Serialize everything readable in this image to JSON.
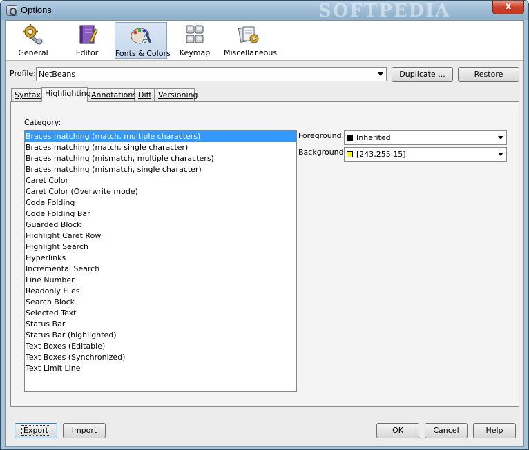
{
  "window": {
    "title": "Options",
    "watermark": "SOFTPEDIA",
    "close_label": "x"
  },
  "toolbar": {
    "items": [
      {
        "label": "General",
        "icon": "gear-wrench-icon"
      },
      {
        "label": "Editor",
        "icon": "notebook-pencil-icon"
      },
      {
        "label": "Fonts & Colors",
        "icon": "font-palette-icon",
        "selected": true
      },
      {
        "label": "Keymap",
        "icon": "keyboard-icon"
      },
      {
        "label": "Miscellaneous",
        "icon": "misc-files-icon"
      }
    ]
  },
  "profile": {
    "label": "Profile:",
    "value": "NetBeans",
    "duplicate_label": "Duplicate ...",
    "restore_label": "Restore"
  },
  "tabs": [
    {
      "label": "Syntax"
    },
    {
      "label": "Highlighting",
      "active": true
    },
    {
      "label": "Annotations"
    },
    {
      "label": "Diff"
    },
    {
      "label": "Versioning"
    }
  ],
  "highlighting": {
    "category_label": "Category:",
    "categories": [
      "Braces matching (match, multiple characters)",
      "Braces matching (match, single character)",
      "Braces matching (mismatch, multiple characters)",
      "Braces matching (mismatch, single character)",
      "Caret Color",
      "Caret Color (Overwrite mode)",
      "Code Folding",
      "Code Folding Bar",
      "Guarded Block",
      "Highlight Caret Row",
      "Highlight Search",
      "Hyperlinks",
      "Incremental Search",
      "Line Number",
      "Readonly Files",
      "Search Block",
      "Selected Text",
      "Status Bar",
      "Status Bar (highlighted)",
      "Text Boxes (Editable)",
      "Text Boxes (Synchronized)",
      "Text Limit Line"
    ],
    "selected_index": 0,
    "foreground": {
      "label": "Foreground:",
      "value": "Inherited",
      "swatch": "#000000"
    },
    "background": {
      "label": "Background:",
      "value": "[243,255,15]",
      "swatch": "#f3ff0f"
    }
  },
  "footer": {
    "export_label": "Export",
    "import_label": "Import",
    "ok_label": "OK",
    "cancel_label": "Cancel",
    "help_label": "Help"
  },
  "colors": {
    "selection": "#3399ff",
    "title_bar": "#9dbbd4",
    "close_button": "#c2341e"
  }
}
